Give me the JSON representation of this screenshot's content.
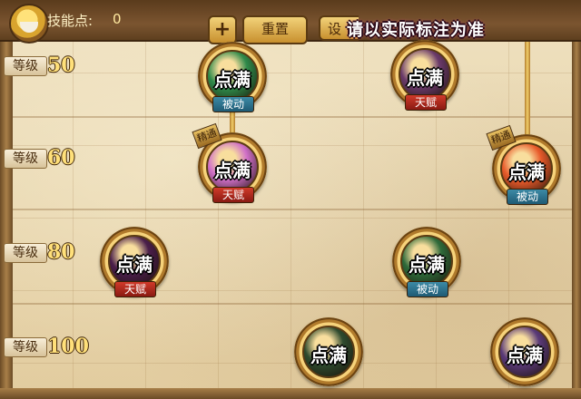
{
  "header": {
    "points_label": "技能点:",
    "points_value": "0",
    "plus_label": "+",
    "reset_label": "重置",
    "settings_label_partial": "设",
    "notice": "请以实际标注为准"
  },
  "levels": [
    {
      "label": "等级",
      "value": "50"
    },
    {
      "label": "等级",
      "value": "60"
    },
    {
      "label": "等级",
      "value": "80"
    },
    {
      "label": "等级",
      "value": "100"
    }
  ],
  "skills": [
    {
      "status": "点满",
      "type": "被动",
      "core_color": "#2f8a4a",
      "level": "50"
    },
    {
      "status": "点满",
      "type": "天赋",
      "core_color": "#6a3a6a",
      "level": "50"
    },
    {
      "status": "点满",
      "type": "天赋",
      "core_color": "#d070c8",
      "level": "60",
      "badge": "精通"
    },
    {
      "status": "点满",
      "type": "被动",
      "core_color": "#e85a2a",
      "level": "60",
      "badge": "精通"
    },
    {
      "status": "点满",
      "type": "天赋",
      "core_color": "#4a1e4a",
      "level": "80"
    },
    {
      "status": "点满",
      "type": "被动",
      "core_color": "#2e6a3a",
      "level": "80"
    },
    {
      "status": "点满",
      "core_color": "#2e4a2e",
      "level": "100"
    },
    {
      "status": "点满",
      "core_color": "#5a3a78",
      "level": "100"
    }
  ],
  "colors": {
    "passive_tag": "#2f7894",
    "talent_tag": "#b02a1e",
    "notice_glow": "#ff4a9a",
    "level_number": "#ffe07a"
  }
}
